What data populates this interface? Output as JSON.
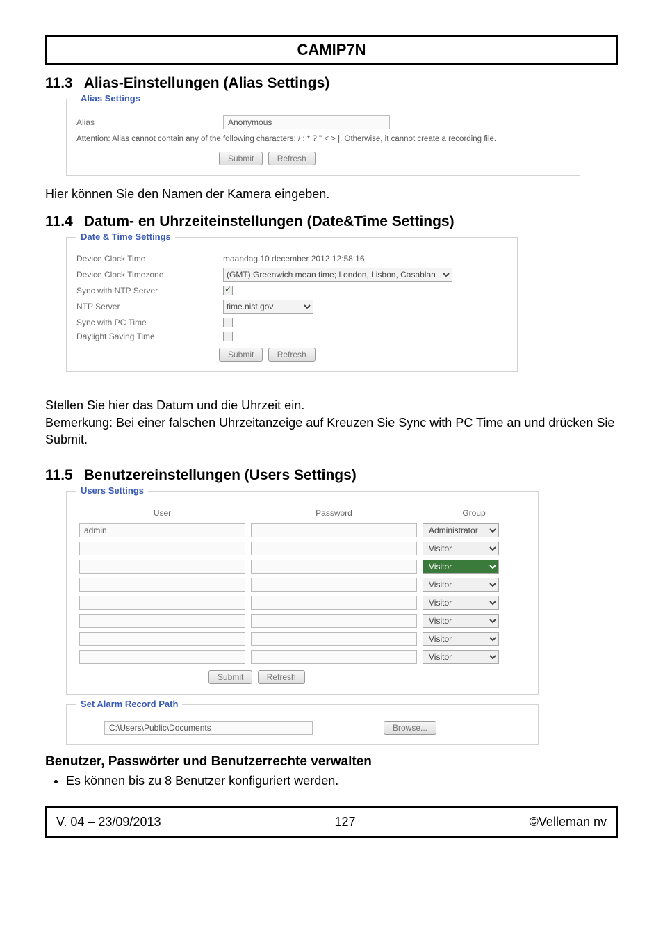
{
  "header": {
    "title": "CAMIP7N"
  },
  "s11_3": {
    "num": "11.3",
    "title": "Alias-Einstellungen (Alias Settings)",
    "panel": {
      "legend": "Alias Settings",
      "alias_label": "Alias",
      "alias_value": "Anonymous",
      "attention": "Attention: Alias cannot contain any of the following characters: / : * ? \" < > |. Otherwise, it cannot create a recording file.",
      "submit": "Submit",
      "refresh": "Refresh"
    },
    "body": "Hier können Sie den Namen der Kamera eingeben."
  },
  "s11_4": {
    "num": "11.4",
    "title": "Datum- en Uhrzeiteinstellungen (Date&Time Settings)",
    "panel": {
      "legend": "Date & Time Settings",
      "rows": {
        "clock_time_label": "Device Clock Time",
        "clock_time_value": "maandag 10 december 2012 12:58:16",
        "timezone_label": "Device Clock Timezone",
        "timezone_value": "(GMT) Greenwich mean time; London, Lisbon, Casablan",
        "sync_ntp_label": "Sync with NTP Server",
        "ntp_server_label": "NTP Server",
        "ntp_server_value": "time.nist.gov",
        "sync_pc_label": "Sync with PC Time",
        "dst_label": "Daylight Saving Time"
      },
      "submit": "Submit",
      "refresh": "Refresh"
    },
    "body1": "Stellen Sie hier das Datum und die Uhrzeit ein.",
    "body2": "Bemerkung: Bei einer falschen Uhrzeitanzeige auf Kreuzen Sie Sync with PC Time an und drücken Sie Submit."
  },
  "s11_5": {
    "num": "11.5",
    "title": "Benutzereinstellungen (Users Settings)",
    "panel": {
      "legend": "Users Settings",
      "headers": {
        "user": "User",
        "password": "Password",
        "group": "Group"
      },
      "rows": [
        {
          "user": "admin",
          "group": "Administrator"
        },
        {
          "user": "",
          "group": "Visitor"
        },
        {
          "user": "",
          "group": "Visitor",
          "highlight": true
        },
        {
          "user": "",
          "group": "Visitor"
        },
        {
          "user": "",
          "group": "Visitor"
        },
        {
          "user": "",
          "group": "Visitor"
        },
        {
          "user": "",
          "group": "Visitor"
        },
        {
          "user": "",
          "group": "Visitor"
        }
      ],
      "submit": "Submit",
      "refresh": "Refresh"
    },
    "path_panel": {
      "legend": "Set Alarm Record Path",
      "path": "C:\\Users\\Public\\Documents",
      "browse": "Browse..."
    },
    "sub_heading": "Benutzer, Passwörter und Benutzerrechte verwalten",
    "bullet1": "Es können bis zu 8 Benutzer konfiguriert werden."
  },
  "footer": {
    "left": "V. 04 – 23/09/2013",
    "center": "127",
    "right": "©Velleman nv"
  }
}
